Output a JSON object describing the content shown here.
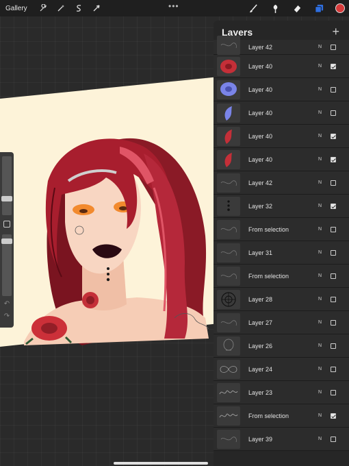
{
  "toolbar": {
    "gallery_label": "Gallery",
    "left_icons": [
      "wrench-icon",
      "magic-wand-icon",
      "selection-icon",
      "transform-arrow-icon"
    ],
    "right_icons": [
      "brush-icon",
      "smudge-icon",
      "eraser-icon",
      "layers-icon"
    ],
    "active_color": "#d63a3a",
    "layers_icon_color": "#2f6fe0"
  },
  "layers": {
    "title": "Layers",
    "add_label": "+",
    "items": [
      {
        "name": "Layer 42",
        "blend": "N",
        "visible": false,
        "thumb": "line-art"
      },
      {
        "name": "Layer 40",
        "blend": "N",
        "visible": true,
        "thumb": "red-rose"
      },
      {
        "name": "Layer 40",
        "blend": "N",
        "visible": false,
        "thumb": "blue-rose"
      },
      {
        "name": "Layer 40",
        "blend": "N",
        "visible": false,
        "thumb": "blue-leaf"
      },
      {
        "name": "Layer 40",
        "blend": "N",
        "visible": true,
        "thumb": "red-leaf"
      },
      {
        "name": "Layer 40",
        "blend": "N",
        "visible": true,
        "thumb": "red-leaf"
      },
      {
        "name": "Layer 42",
        "blend": "N",
        "visible": false,
        "thumb": "line-art"
      },
      {
        "name": "Layer 32",
        "blend": "N",
        "visible": true,
        "thumb": "dots"
      },
      {
        "name": "From selection",
        "blend": "N",
        "visible": false,
        "thumb": "line-art"
      },
      {
        "name": "Layer 31",
        "blend": "N",
        "visible": false,
        "thumb": "line-art"
      },
      {
        "name": "From selection",
        "blend": "N",
        "visible": false,
        "thumb": "line-art"
      },
      {
        "name": "Layer 28",
        "blend": "N",
        "visible": false,
        "thumb": "mandala"
      },
      {
        "name": "Layer 27",
        "blend": "N",
        "visible": false,
        "thumb": "line-art"
      },
      {
        "name": "Layer 26",
        "blend": "N",
        "visible": false,
        "thumb": "skull"
      },
      {
        "name": "Layer 24",
        "blend": "N",
        "visible": false,
        "thumb": "infinity"
      },
      {
        "name": "Layer 23",
        "blend": "N",
        "visible": false,
        "thumb": "lettering"
      },
      {
        "name": "From selection",
        "blend": "N",
        "visible": true,
        "thumb": "lettering"
      },
      {
        "name": "Layer 39",
        "blend": "N",
        "visible": false,
        "thumb": "line-art"
      }
    ]
  },
  "side_panel": {
    "brush_size_level": 0.3,
    "opacity_level": 0.2,
    "undo_icon": "undo-icon",
    "redo_icon": "redo-icon"
  }
}
